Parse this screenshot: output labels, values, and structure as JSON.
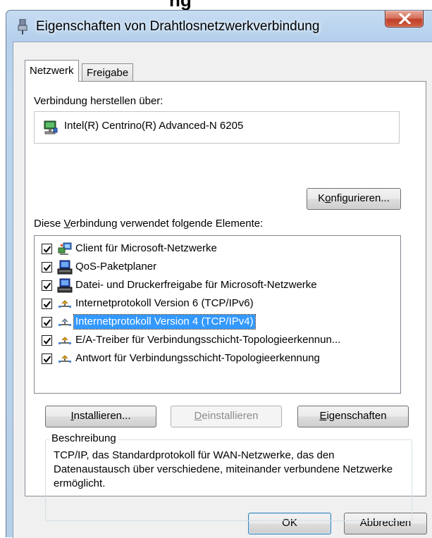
{
  "background_fragment": "ng",
  "window": {
    "title": "Eigenschaften von Drahtlosnetzwerkverbindung",
    "close_label": "close"
  },
  "tabs": [
    {
      "label": "Netzwerk",
      "active": true
    },
    {
      "label": "Freigabe",
      "active": false
    }
  ],
  "connect_via": {
    "label": "Verbindung herstellen über:",
    "adapter": "Intel(R) Centrino(R) Advanced-N 6205",
    "configure_button": {
      "pre": "K",
      "u": "o",
      "post": "nfigurieren..."
    }
  },
  "elements": {
    "label": {
      "pre": "Diese ",
      "u": "V",
      "post": "erbindung verwendet folgende Elemente:"
    },
    "items": [
      {
        "label": "Client für Microsoft-Netzwerke",
        "checked": true,
        "icon": "network-client-icon",
        "selected": false
      },
      {
        "label": "QoS-Paketplaner",
        "checked": true,
        "icon": "service-icon",
        "selected": false
      },
      {
        "label": "Datei- und Druckerfreigabe für Microsoft-Netzwerke",
        "checked": true,
        "icon": "service-icon",
        "selected": false
      },
      {
        "label": "Internetprotokoll Version 6 (TCP/IPv6)",
        "checked": true,
        "icon": "protocol-icon",
        "selected": false
      },
      {
        "label": "Internetprotokoll Version 4 (TCP/IPv4)",
        "checked": true,
        "icon": "protocol-icon",
        "selected": true
      },
      {
        "label": "E/A-Treiber für Verbindungsschicht-Topologieerkennun...",
        "checked": true,
        "icon": "protocol-icon",
        "selected": false
      },
      {
        "label": "Antwort für Verbindungsschicht-Topologieerkennung",
        "checked": true,
        "icon": "protocol-icon",
        "selected": false
      }
    ]
  },
  "actions": {
    "install": {
      "pre": "",
      "u": "I",
      "post": "nstallieren..."
    },
    "uninstall": {
      "pre": "",
      "u": "D",
      "post": "einstallieren"
    },
    "properties": {
      "pre": "",
      "u": "E",
      "post": "igenschaften"
    }
  },
  "description": {
    "legend": "Beschreibung",
    "text": "TCP/IP, das Standardprotokoll für WAN-Netzwerke, das den Datenaustausch über verschiedene, miteinander verbundene Netzwerke ermöglicht."
  },
  "footer": {
    "ok": "OK",
    "cancel": "Abbrechen"
  },
  "colors": {
    "selection": "#3399ff",
    "close_button": "#c7432b",
    "frame": "#bcd5ee"
  }
}
